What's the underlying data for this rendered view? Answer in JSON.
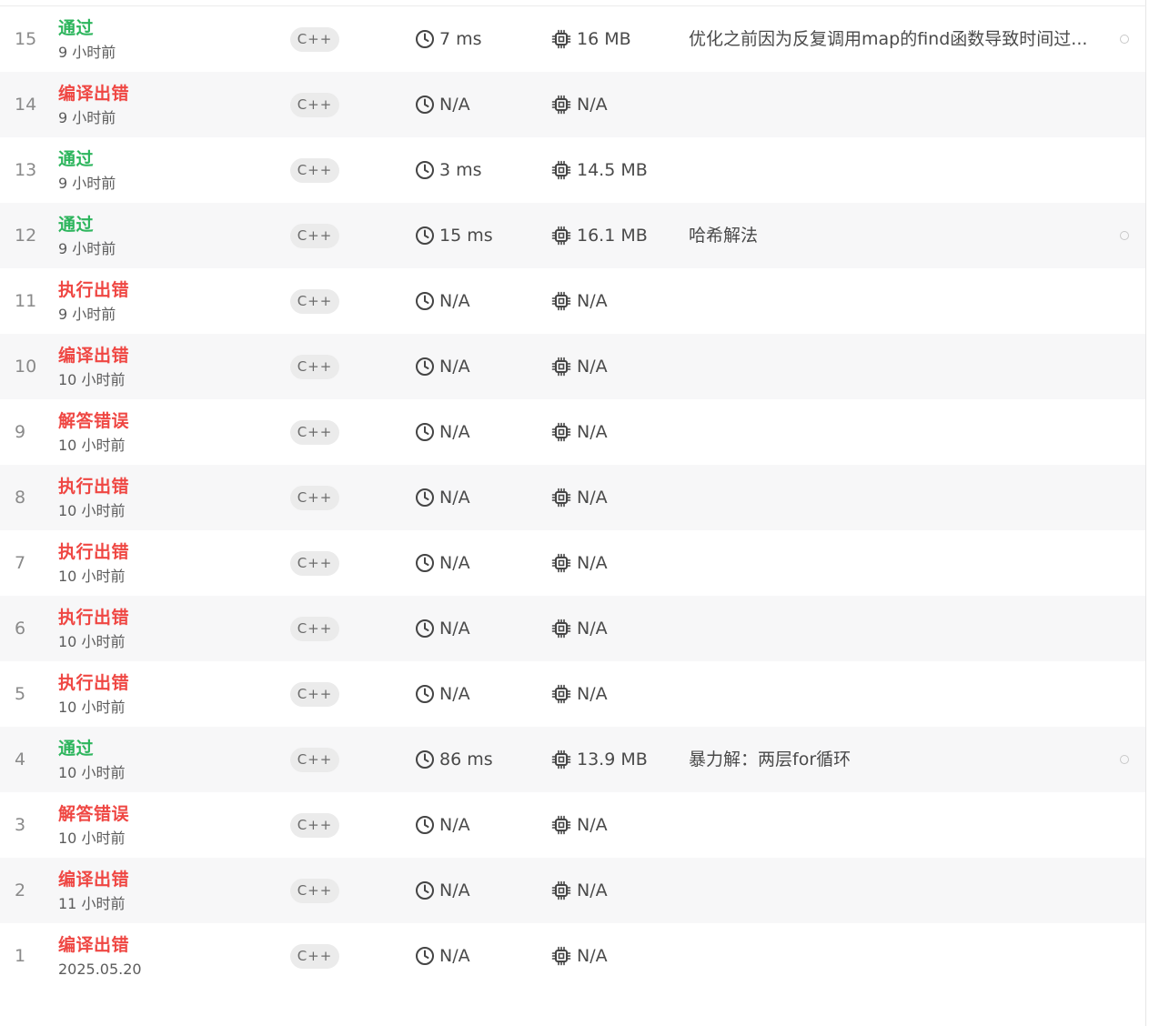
{
  "submissions": [
    {
      "id": "15",
      "status": "通过",
      "ok": true,
      "time": "9 小时前",
      "lang": "C++",
      "runtime": "7 ms",
      "memory": "16 MB",
      "note": "优化之前因为反复调用map的find函数导致时间过..."
    },
    {
      "id": "14",
      "status": "编译出错",
      "ok": false,
      "time": "9 小时前",
      "lang": "C++",
      "runtime": "N/A",
      "memory": "N/A",
      "note": ""
    },
    {
      "id": "13",
      "status": "通过",
      "ok": true,
      "time": "9 小时前",
      "lang": "C++",
      "runtime": "3 ms",
      "memory": "14.5 MB",
      "note": ""
    },
    {
      "id": "12",
      "status": "通过",
      "ok": true,
      "time": "9 小时前",
      "lang": "C++",
      "runtime": "15 ms",
      "memory": "16.1 MB",
      "note": "哈希解法"
    },
    {
      "id": "11",
      "status": "执行出错",
      "ok": false,
      "time": "9 小时前",
      "lang": "C++",
      "runtime": "N/A",
      "memory": "N/A",
      "note": ""
    },
    {
      "id": "10",
      "status": "编译出错",
      "ok": false,
      "time": "10 小时前",
      "lang": "C++",
      "runtime": "N/A",
      "memory": "N/A",
      "note": ""
    },
    {
      "id": "9",
      "status": "解答错误",
      "ok": false,
      "time": "10 小时前",
      "lang": "C++",
      "runtime": "N/A",
      "memory": "N/A",
      "note": ""
    },
    {
      "id": "8",
      "status": "执行出错",
      "ok": false,
      "time": "10 小时前",
      "lang": "C++",
      "runtime": "N/A",
      "memory": "N/A",
      "note": ""
    },
    {
      "id": "7",
      "status": "执行出错",
      "ok": false,
      "time": "10 小时前",
      "lang": "C++",
      "runtime": "N/A",
      "memory": "N/A",
      "note": ""
    },
    {
      "id": "6",
      "status": "执行出错",
      "ok": false,
      "time": "10 小时前",
      "lang": "C++",
      "runtime": "N/A",
      "memory": "N/A",
      "note": ""
    },
    {
      "id": "5",
      "status": "执行出错",
      "ok": false,
      "time": "10 小时前",
      "lang": "C++",
      "runtime": "N/A",
      "memory": "N/A",
      "note": ""
    },
    {
      "id": "4",
      "status": "通过",
      "ok": true,
      "time": "10 小时前",
      "lang": "C++",
      "runtime": "86 ms",
      "memory": "13.9 MB",
      "note": "暴力解：两层for循环"
    },
    {
      "id": "3",
      "status": "解答错误",
      "ok": false,
      "time": "10 小时前",
      "lang": "C++",
      "runtime": "N/A",
      "memory": "N/A",
      "note": ""
    },
    {
      "id": "2",
      "status": "编译出错",
      "ok": false,
      "time": "11 小时前",
      "lang": "C++",
      "runtime": "N/A",
      "memory": "N/A",
      "note": ""
    },
    {
      "id": "1",
      "status": "编译出错",
      "ok": false,
      "time": "2025.05.20",
      "lang": "C++",
      "runtime": "N/A",
      "memory": "N/A",
      "note": ""
    }
  ],
  "icons": {
    "runtime": "clock-icon",
    "memory": "chip-icon",
    "note": "note-dot-icon"
  },
  "colors": {
    "accepted": "#2db55d",
    "error": "#ef4743",
    "row_alt": "#f7f7f8",
    "lang_badge": "#ebebeb"
  }
}
